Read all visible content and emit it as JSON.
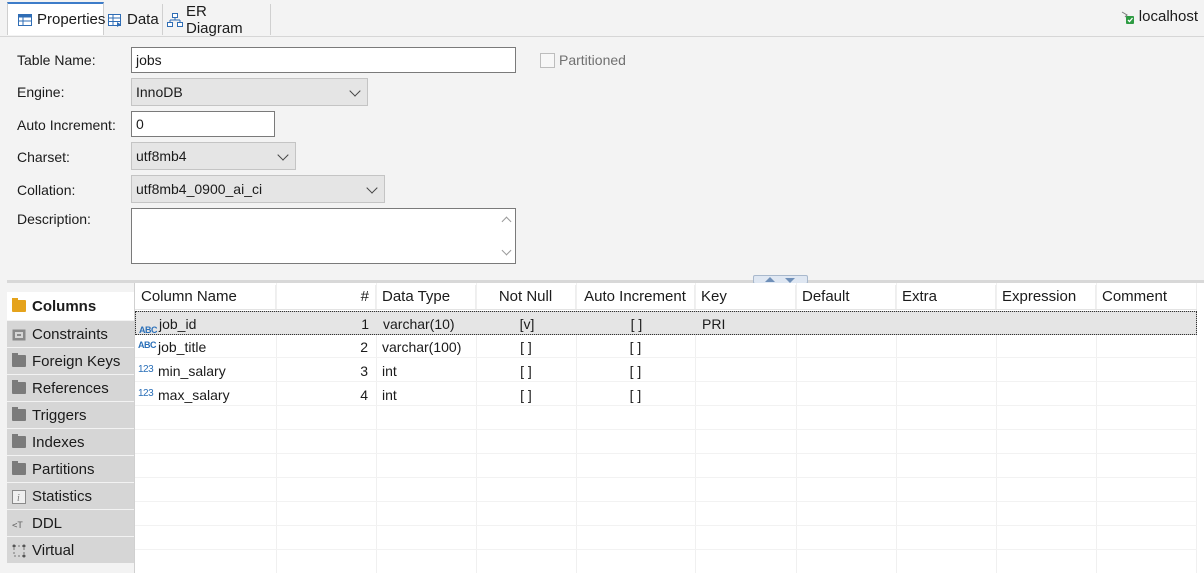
{
  "tabs": [
    {
      "label": "Properties",
      "icon": "table-properties-icon",
      "active": true
    },
    {
      "label": "Data",
      "icon": "data-grid-icon",
      "active": false
    },
    {
      "label": "ER Diagram",
      "icon": "er-diagram-icon",
      "active": false
    }
  ],
  "connection": {
    "label": "localhost",
    "icon": "connection-icon"
  },
  "form": {
    "table_name_label": "Table Name:",
    "table_name_value": "jobs",
    "partitioned_label": "Partitioned",
    "engine_label": "Engine:",
    "engine_value": "InnoDB",
    "auto_increment_label": "Auto Increment:",
    "auto_increment_value": "0",
    "charset_label": "Charset:",
    "charset_value": "utf8mb4",
    "collation_label": "Collation:",
    "collation_value": "utf8mb4_0900_ai_ci",
    "description_label": "Description:",
    "description_value": ""
  },
  "sidetabs": [
    {
      "label": "Columns",
      "icon": "columns-icon",
      "active": true
    },
    {
      "label": "Constraints",
      "icon": "constraints-icon"
    },
    {
      "label": "Foreign Keys",
      "icon": "folder-icon"
    },
    {
      "label": "References",
      "icon": "folder-icon"
    },
    {
      "label": "Triggers",
      "icon": "folder-icon"
    },
    {
      "label": "Indexes",
      "icon": "folder-icon"
    },
    {
      "label": "Partitions",
      "icon": "folder-icon"
    },
    {
      "label": "Statistics",
      "icon": "info-icon"
    },
    {
      "label": "DDL",
      "icon": "ddl-icon"
    },
    {
      "label": "Virtual",
      "icon": "virtual-icon"
    }
  ],
  "columns_table": {
    "headers": [
      "Column Name",
      "#",
      "Data Type",
      "Not Null",
      "Auto Increment",
      "Key",
      "Default",
      "Extra",
      "Expression",
      "Comment"
    ],
    "rows": [
      {
        "type_icon": "ABC",
        "name": "job_id",
        "num": "1",
        "data_type": "varchar(10)",
        "not_null": "[v]",
        "auto_increment": "[ ]",
        "key": "PRI",
        "default": "",
        "extra": "",
        "expression": "",
        "comment": ""
      },
      {
        "type_icon": "ABC",
        "name": "job_title",
        "num": "2",
        "data_type": "varchar(100)",
        "not_null": "[ ]",
        "auto_increment": "[ ]",
        "key": "",
        "default": "",
        "extra": "",
        "expression": "",
        "comment": ""
      },
      {
        "type_icon": "123",
        "name": "min_salary",
        "num": "3",
        "data_type": "int",
        "not_null": "[ ]",
        "auto_increment": "[ ]",
        "key": "",
        "default": "",
        "extra": "",
        "expression": "",
        "comment": ""
      },
      {
        "type_icon": "123",
        "name": "max_salary",
        "num": "4",
        "data_type": "int",
        "not_null": "[ ]",
        "auto_increment": "[ ]",
        "key": "",
        "default": "",
        "extra": "",
        "expression": "",
        "comment": ""
      }
    ]
  }
}
